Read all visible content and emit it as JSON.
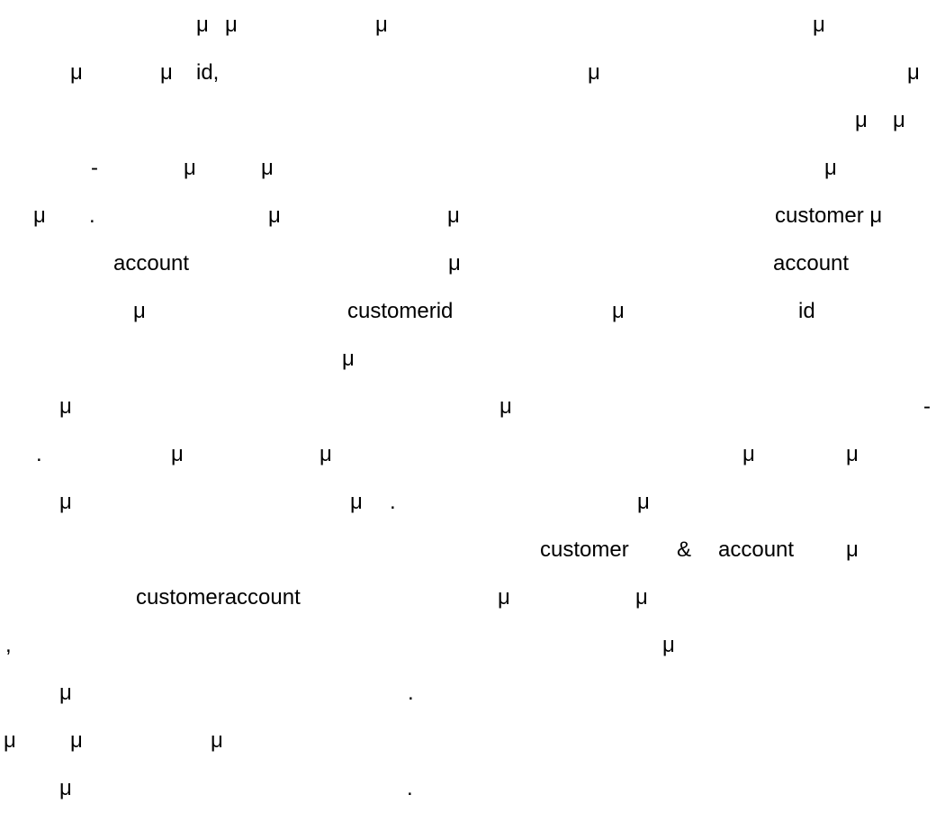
{
  "document": {
    "lines": [
      {
        "fragments": [
          "μ",
          "μ",
          "μ",
          "μ"
        ]
      },
      {
        "fragments": [
          "μ",
          "μ",
          "id,",
          "μ",
          "μ"
        ]
      },
      {
        "fragments": [
          "μ",
          "μ"
        ]
      },
      {
        "fragments": [
          "-",
          "μ",
          "μ",
          "μ"
        ]
      },
      {
        "fragments": [
          "μ",
          ".",
          "μ",
          "μ",
          "customer μ"
        ]
      },
      {
        "fragments": [
          "account",
          "μ",
          "account"
        ]
      },
      {
        "fragments": [
          "μ",
          "customerid",
          "μ",
          "id"
        ]
      },
      {
        "fragments": [
          "μ"
        ]
      },
      {
        "fragments": [
          "μ",
          "μ",
          "-"
        ]
      },
      {
        "fragments": [
          ".",
          "μ",
          "μ",
          "μ",
          "μ"
        ]
      },
      {
        "fragments": [
          "μ",
          "μ",
          ".",
          "μ"
        ]
      },
      {
        "fragments": [
          "customer",
          "&",
          "account",
          "μ"
        ]
      },
      {
        "fragments": [
          "customeraccount",
          "μ",
          "μ"
        ]
      },
      {
        "fragments": [
          ",",
          "μ"
        ]
      },
      {
        "fragments": [
          "μ",
          "."
        ]
      },
      {
        "fragments": [
          "μ",
          "μ",
          "μ"
        ]
      },
      {
        "fragments": [
          "μ",
          "."
        ]
      }
    ]
  }
}
